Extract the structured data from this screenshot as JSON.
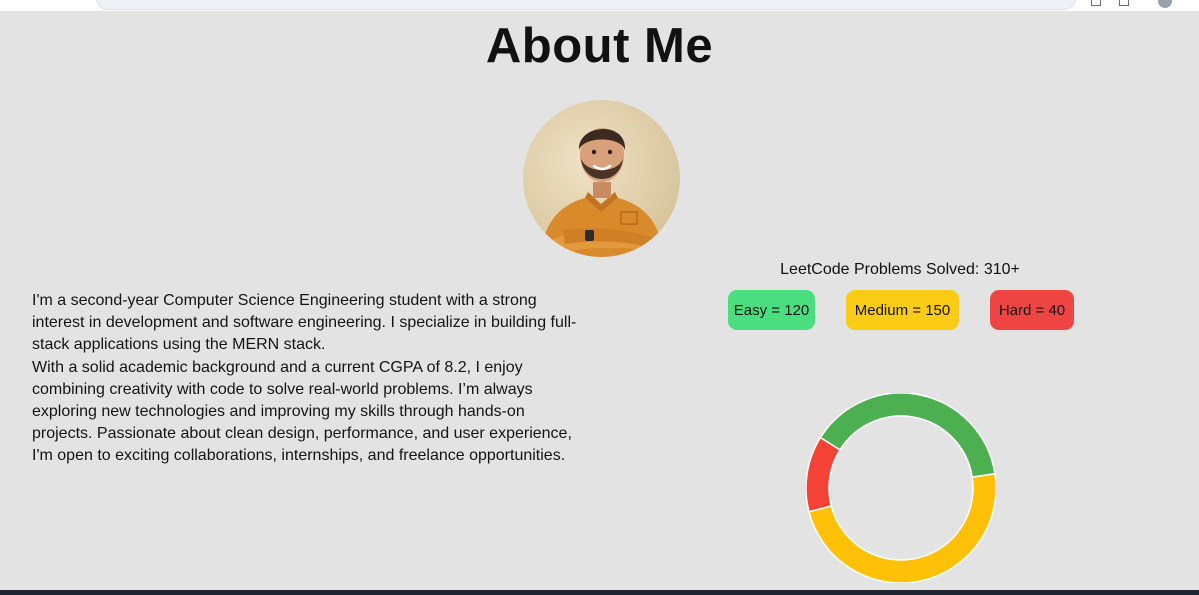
{
  "page": {
    "title": "About Me"
  },
  "bio": {
    "paragraph1": "I'm a second-year Computer Science Engineering student with a strong interest in development and software engineering. I specialize in building full-stack applications using the MERN stack.",
    "paragraph2": "With a solid academic background and a current CGPA of 8.2, I enjoy combining creativity with code to solve real-world problems. I’m always exploring new technologies and improving my skills through hands-on projects. Passionate about clean design, performance, and user experience, I'm open to exciting collaborations, internships, and freelance opportunities."
  },
  "leetcode": {
    "title": "LeetCode Problems Solved: 310+",
    "easy_label": "Easy = 120",
    "medium_label": "Medium = 150",
    "hard_label": "Hard = 40"
  },
  "colors": {
    "easy": "#4caf50",
    "medium": "#ffc107",
    "hard": "#f44336",
    "background": "#e3e3e3"
  },
  "chart_data": {
    "type": "pie",
    "variant": "doughnut",
    "categories": [
      "Easy",
      "Medium",
      "Hard"
    ],
    "values": [
      120,
      150,
      40
    ],
    "colors": [
      "#4caf50",
      "#ffc107",
      "#f44336"
    ],
    "legend": "none"
  }
}
